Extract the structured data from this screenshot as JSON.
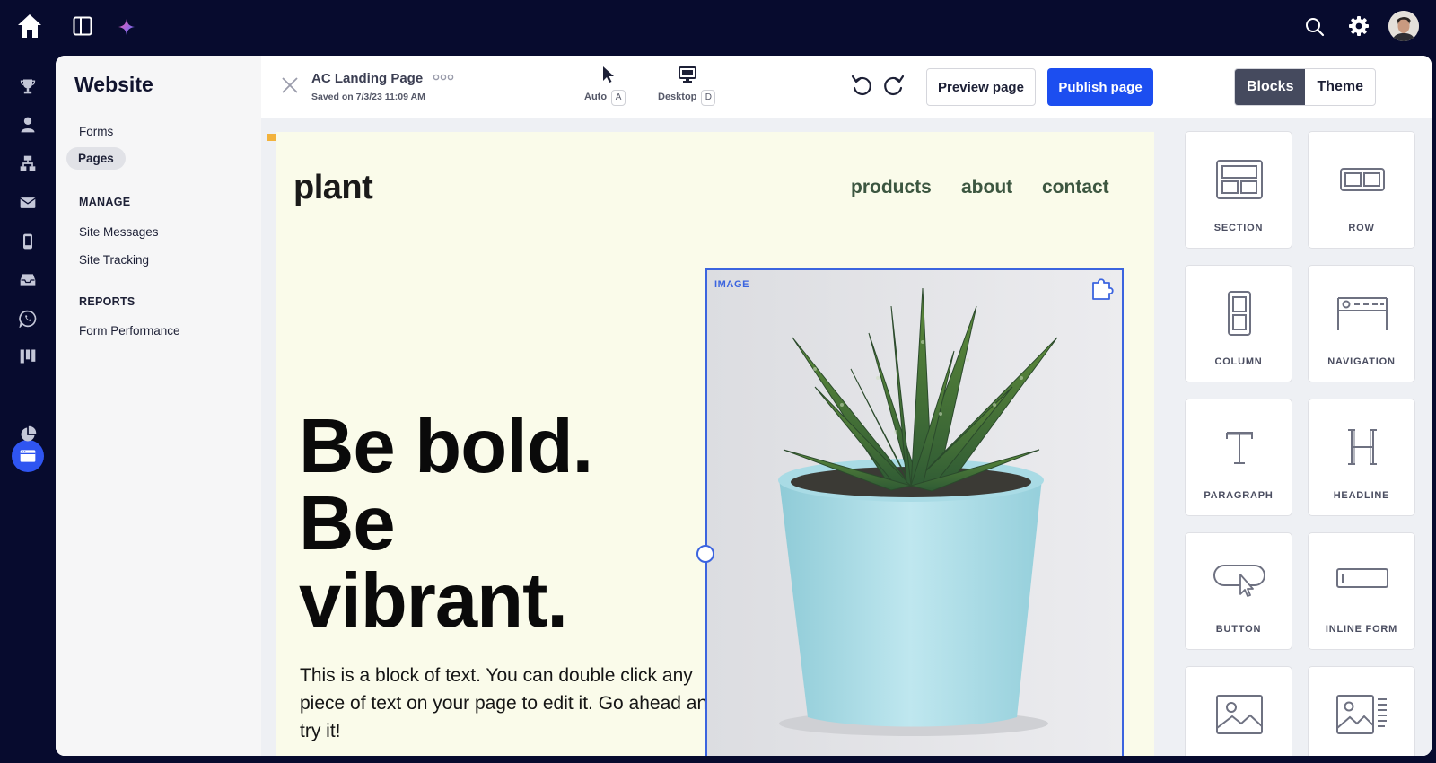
{
  "topbar": {
    "icons": [
      "home-icon",
      "sidebar-toggle-icon",
      "sparkle-icon",
      "search-icon",
      "gear-icon",
      "avatar"
    ]
  },
  "rail": {
    "icons": [
      "trophy-icon",
      "contacts-icon",
      "automations-icon",
      "mail-icon",
      "mobile-icon",
      "inbox-icon",
      "whatsapp-icon",
      "pipeline-icon",
      "website-icon",
      "reports-icon"
    ],
    "active": "website-icon"
  },
  "sidenav": {
    "title": "Website",
    "items": [
      {
        "label": "Forms"
      },
      {
        "label": "Pages",
        "selected": true
      }
    ],
    "manage_heading": "MANAGE",
    "manage_items": [
      {
        "label": "Site Messages"
      },
      {
        "label": "Site Tracking"
      }
    ],
    "reports_heading": "REPORTS",
    "reports_items": [
      {
        "label": "Form Performance"
      }
    ]
  },
  "toolbar": {
    "page_name": "AC Landing Page",
    "saved_text": "Saved on 7/3/23 11:09 AM",
    "modes": [
      {
        "label": "Auto",
        "key": "A",
        "icon": "cursor-icon"
      },
      {
        "label": "Desktop",
        "key": "D",
        "icon": "monitor-icon"
      }
    ],
    "preview_label": "Preview page",
    "publish_label": "Publish page",
    "publish_color": "#1c4ef0"
  },
  "landing": {
    "logo": "plant",
    "nav": [
      "products",
      "about",
      "contact"
    ],
    "headline": [
      "Be bold.",
      "Be",
      "vibrant."
    ],
    "body": "This is a block of text. You can double click any piece of text on your page to edit it. Go ahead and try it!",
    "image_tag": "IMAGE",
    "background": "#fafbea",
    "selection_color": "#3b64df"
  },
  "rightpanel": {
    "tabs": [
      {
        "label": "Blocks",
        "active": true
      },
      {
        "label": "Theme",
        "active": false
      }
    ],
    "blocks": [
      {
        "label": "SECTION",
        "icon": "section-icon"
      },
      {
        "label": "ROW",
        "icon": "row-icon"
      },
      {
        "label": "COLUMN",
        "icon": "column-icon"
      },
      {
        "label": "NAVIGATION",
        "icon": "navigation-icon"
      },
      {
        "label": "PARAGRAPH",
        "icon": "paragraph-icon"
      },
      {
        "label": "HEADLINE",
        "icon": "headline-icon"
      },
      {
        "label": "BUTTON",
        "icon": "button-icon"
      },
      {
        "label": "INLINE FORM",
        "icon": "inline-form-icon"
      },
      {
        "label": "",
        "icon": "image-icon"
      },
      {
        "label": "",
        "icon": "image-text-icon"
      }
    ]
  }
}
